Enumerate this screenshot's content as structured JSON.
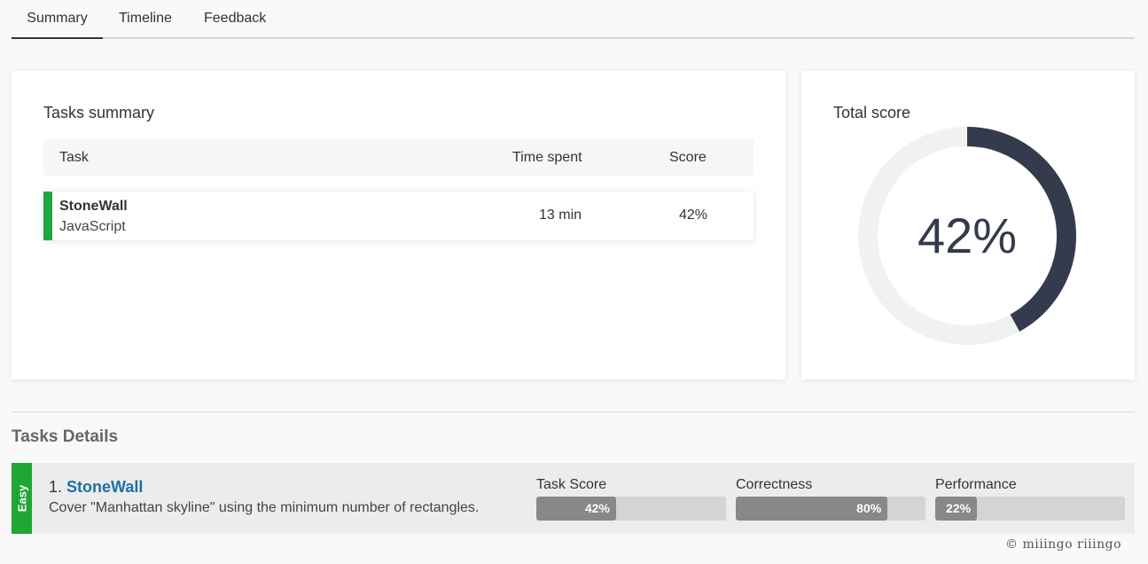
{
  "tabs": [
    {
      "label": "Summary"
    },
    {
      "label": "Timeline"
    },
    {
      "label": "Feedback"
    }
  ],
  "tasks_summary": {
    "title": "Tasks summary",
    "columns": {
      "task": "Task",
      "time": "Time spent",
      "score": "Score"
    },
    "rows": [
      {
        "name": "StoneWall",
        "language": "JavaScript",
        "time": "13 min",
        "score": "42%"
      }
    ]
  },
  "total_score": {
    "title": "Total score",
    "value_text": "42%",
    "fraction": 0.42,
    "colors": {
      "arc": "#333b4c",
      "track": "#f1f1f1"
    }
  },
  "details": {
    "title": "Tasks Details",
    "tasks": [
      {
        "difficulty": "Easy",
        "number": "1.",
        "name": "StoneWall",
        "description": "Cover \"Manhattan skyline\" using the minimum number of rectangles.",
        "metrics": [
          {
            "label": "Task Score",
            "value": 42,
            "text": "42%"
          },
          {
            "label": "Correctness",
            "value": 80,
            "text": "80%"
          },
          {
            "label": "Performance",
            "value": 22,
            "text": "22%"
          }
        ]
      }
    ]
  },
  "colors": {
    "accent_green": "#1fa733",
    "link": "#1e6fa6",
    "bar_fill": "#888888",
    "bar_track": "#d4d4d4"
  },
  "footer": {
    "logo": "© miiingo riiingo"
  }
}
